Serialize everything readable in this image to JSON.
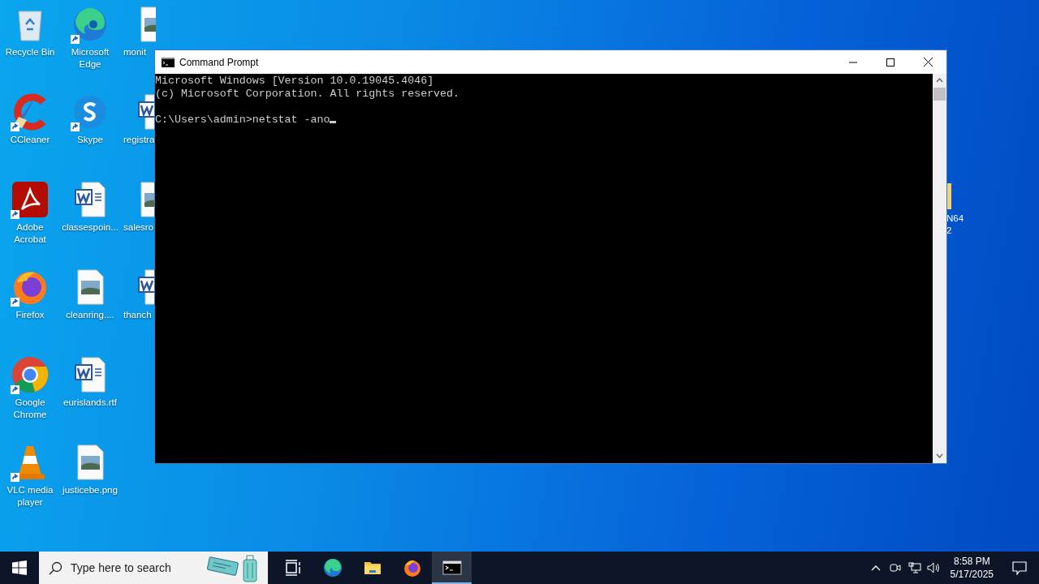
{
  "desktop": {
    "columns": [
      [
        {
          "label": "Recycle Bin",
          "kind": "recycle-bin",
          "shortcut": false
        },
        {
          "label": "CCleaner",
          "kind": "ccleaner",
          "shortcut": true
        },
        {
          "label": "Adobe Acrobat",
          "kind": "acrobat",
          "shortcut": true
        },
        {
          "label": "Firefox",
          "kind": "firefox",
          "shortcut": true
        },
        {
          "label": "Google Chrome",
          "kind": "chrome",
          "shortcut": true
        },
        {
          "label": "VLC media player",
          "kind": "vlc",
          "shortcut": true
        }
      ],
      [
        {
          "label": "Microsoft Edge",
          "kind": "edge",
          "shortcut": true
        },
        {
          "label": "Skype",
          "kind": "skype",
          "shortcut": true
        },
        {
          "label": "classespoin...",
          "kind": "word",
          "shortcut": false
        },
        {
          "label": "cleanring....",
          "kind": "image",
          "shortcut": false
        },
        {
          "label": "eurislands.rtf",
          "kind": "word",
          "shortcut": false
        },
        {
          "label": "justicebe.png",
          "kind": "image",
          "shortcut": false
        }
      ],
      [
        {
          "label": "monit",
          "kind": "image",
          "shortcut": false
        },
        {
          "label": "registra",
          "kind": "word",
          "shortcut": false
        },
        {
          "label": "salesro",
          "kind": "image",
          "shortcut": false
        },
        {
          "label": "thanch",
          "kind": "word",
          "shortcut": false
        }
      ]
    ],
    "edge_item": {
      "label": "N64 2",
      "kind": "folder"
    }
  },
  "window": {
    "title": "Command Prompt",
    "console": {
      "lines": [
        "Microsoft Windows [Version 10.0.19045.4046]",
        "(c) Microsoft Corporation. All rights reserved."
      ],
      "prompt_line": "C:\\Users\\admin>netstat -ano",
      "cursor": true
    }
  },
  "taskbar": {
    "search": {
      "placeholder": "Type here to search"
    },
    "apps": [
      {
        "kind": "task-view",
        "selected": false
      },
      {
        "kind": "edge",
        "selected": false
      },
      {
        "kind": "explorer",
        "selected": false
      },
      {
        "kind": "firefox",
        "selected": false
      },
      {
        "kind": "cmd",
        "selected": true
      }
    ],
    "clock": {
      "time": "8:58 PM",
      "date": "5/17/2025"
    }
  }
}
